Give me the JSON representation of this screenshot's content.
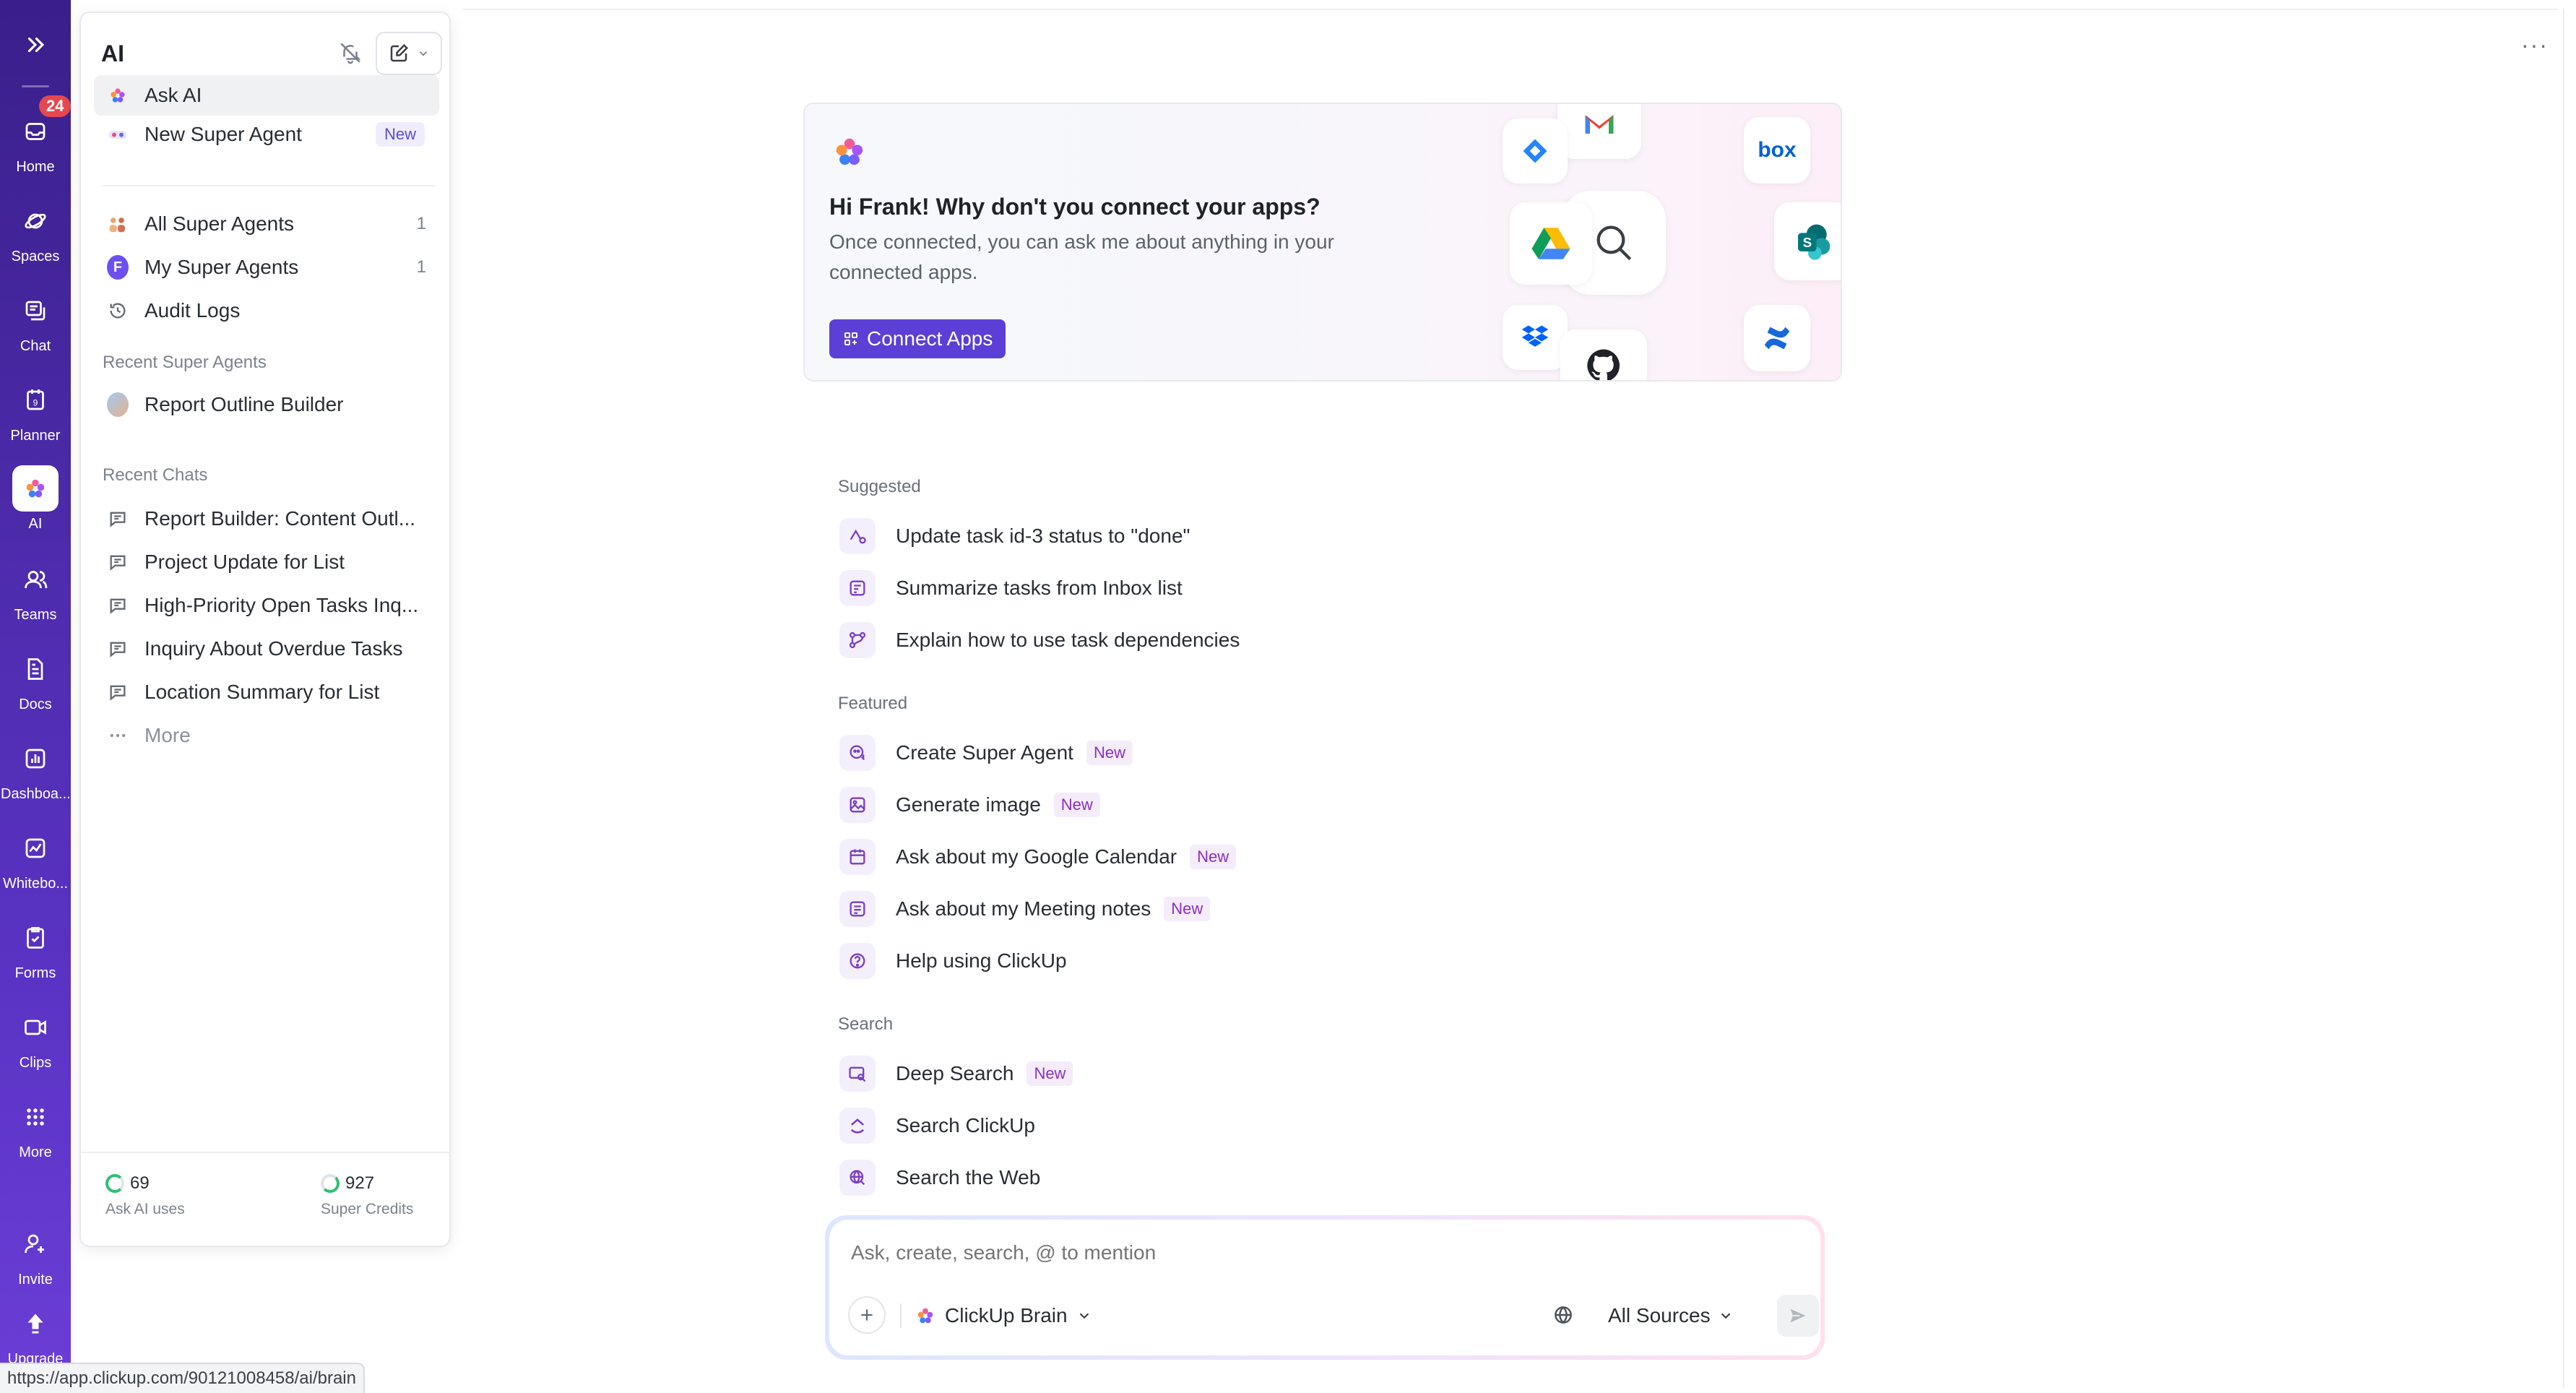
{
  "rail": {
    "items": [
      {
        "label": "Home",
        "icon": "inbox-icon"
      },
      {
        "label": "Spaces",
        "icon": "planet-icon"
      },
      {
        "label": "Chat",
        "icon": "chat-icon"
      },
      {
        "label": "Planner",
        "icon": "calendar-icon"
      },
      {
        "label": "AI",
        "icon": "brain-icon"
      },
      {
        "label": "Teams",
        "icon": "teams-icon"
      },
      {
        "label": "Docs",
        "icon": "doc-icon"
      },
      {
        "label": "Dashboa...",
        "icon": "dashboard-icon"
      },
      {
        "label": "Whitebo...",
        "icon": "whiteboard-icon"
      },
      {
        "label": "Forms",
        "icon": "form-icon"
      },
      {
        "label": "Clips",
        "icon": "video-icon"
      },
      {
        "label": "More",
        "icon": "grid-icon"
      },
      {
        "label": "Invite",
        "icon": "invite-icon"
      },
      {
        "label": "Upgrade",
        "icon": "upgrade-icon"
      }
    ],
    "home_badge": "24"
  },
  "panel": {
    "title": "AI",
    "ask_ai": "Ask AI",
    "new_super_agent": "New Super Agent",
    "new_tag": "New",
    "all_super_agents": "All Super Agents",
    "all_super_agents_count": "1",
    "my_super_agents": "My Super Agents",
    "my_super_agents_count": "1",
    "my_avatar_letter": "F",
    "audit_logs": "Audit Logs",
    "recent_agents_heading": "Recent Super Agents",
    "recent_agents": [
      "Report Outline Builder"
    ],
    "recent_chats_heading": "Recent Chats",
    "recent_chats": [
      "Report Builder: Content Outl...",
      "Project Update for List",
      "High-Priority Open Tasks Inq...",
      "Inquiry About Overdue Tasks",
      "Location Summary for List"
    ],
    "more": "More",
    "ask_ai_uses_value": "69",
    "ask_ai_uses_label": "Ask AI uses",
    "super_credits_value": "927",
    "super_credits_label": "Super Credits"
  },
  "connect": {
    "title": "Hi Frank! Why don't you connect your apps?",
    "subtitle": "Once connected, you can ask me about anything in your connected apps.",
    "button": "Connect Apps",
    "box_label": "box",
    "sharepoint_letter": "S"
  },
  "suggested": {
    "heading": "Suggested",
    "items": [
      "Update task id-3 status to \"done\"",
      "Summarize tasks from Inbox list",
      "Explain how to use task dependencies"
    ]
  },
  "featured": {
    "heading": "Featured",
    "items": [
      {
        "label": "Create Super Agent",
        "tag": "New"
      },
      {
        "label": "Generate image",
        "tag": "New"
      },
      {
        "label": "Ask about my Google Calendar",
        "tag": "New"
      },
      {
        "label": "Ask about my Meeting notes",
        "tag": "New"
      },
      {
        "label": "Help using ClickUp",
        "tag": ""
      }
    ]
  },
  "search": {
    "heading": "Search",
    "items": [
      {
        "label": "Deep Search",
        "tag": "New"
      },
      {
        "label": "Search ClickUp",
        "tag": ""
      },
      {
        "label": "Search the Web",
        "tag": ""
      }
    ]
  },
  "composer": {
    "placeholder": "Ask, create, search, @ to mention",
    "model": "ClickUp Brain",
    "sources": "All Sources"
  },
  "status_url": "https://app.clickup.com/90121008458/ai/brain",
  "colors": {
    "rail_top": "#3a1f8a",
    "rail_bottom": "#6b3ed6",
    "accent": "#5b3fd6",
    "new_tag": "#8a2fc0",
    "badge": "#e5484d"
  }
}
